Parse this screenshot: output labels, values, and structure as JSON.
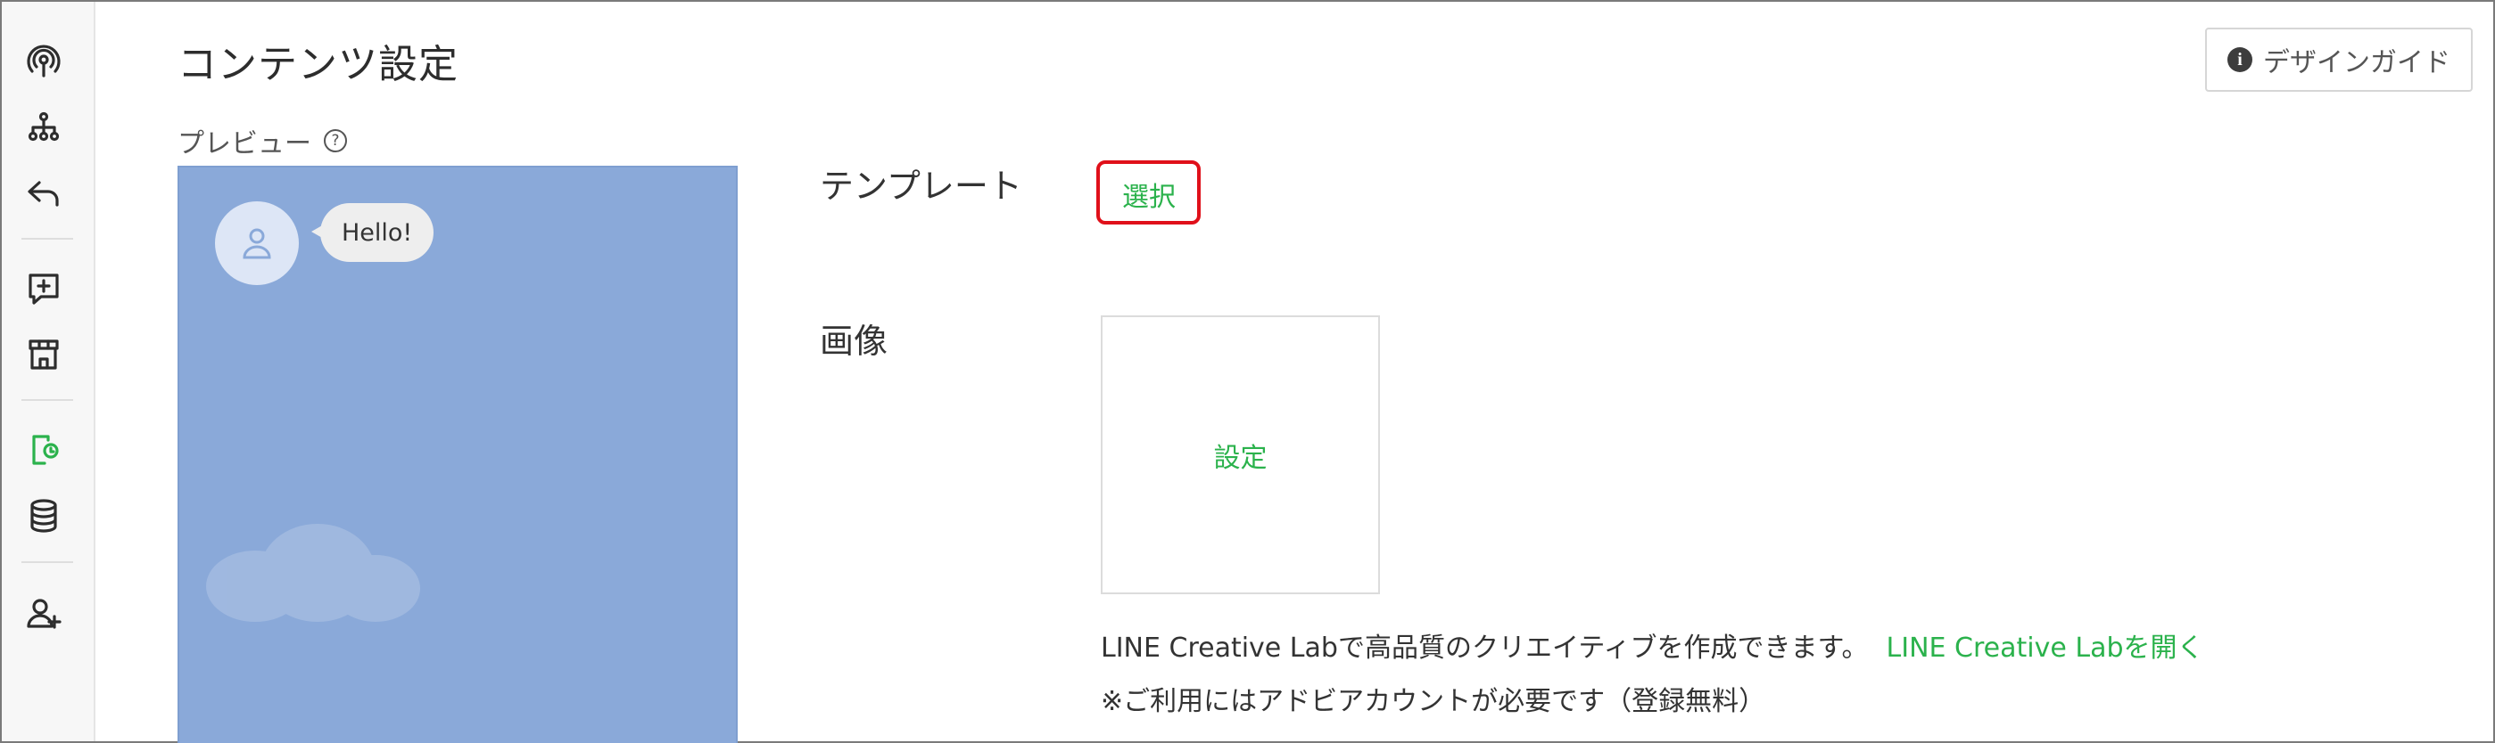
{
  "sidebar": {
    "icons": [
      {
        "name": "broadcast-icon"
      },
      {
        "name": "sitemap-icon"
      },
      {
        "name": "reply-icon"
      },
      {
        "name": "add-message-icon"
      },
      {
        "name": "shop-icon"
      },
      {
        "name": "rich-menu-icon",
        "active": true
      },
      {
        "name": "database-icon"
      },
      {
        "name": "add-friend-icon"
      }
    ],
    "active_color": "#2bb24c"
  },
  "header": {
    "title": "コンテンツ設定",
    "design_guide_label": "デザインガイド"
  },
  "preview": {
    "label": "プレビュー",
    "help_glyph": "?",
    "bubble_text": "Hello!",
    "background_color": "#8aa9d9"
  },
  "form": {
    "template": {
      "label": "テンプレート",
      "select_label": "選択"
    },
    "image": {
      "label": "画像",
      "set_label": "設定"
    },
    "creative_lab": {
      "text": "LINE Creative Labで高品質のクリエイティブを作成できます。",
      "link": "LINE Creative Labを開く",
      "note": "※ご利用にはアドビアカウントが必要です（登録無料）"
    }
  },
  "colors": {
    "accent_green": "#2bb24c",
    "highlight_red": "#e0101a"
  }
}
